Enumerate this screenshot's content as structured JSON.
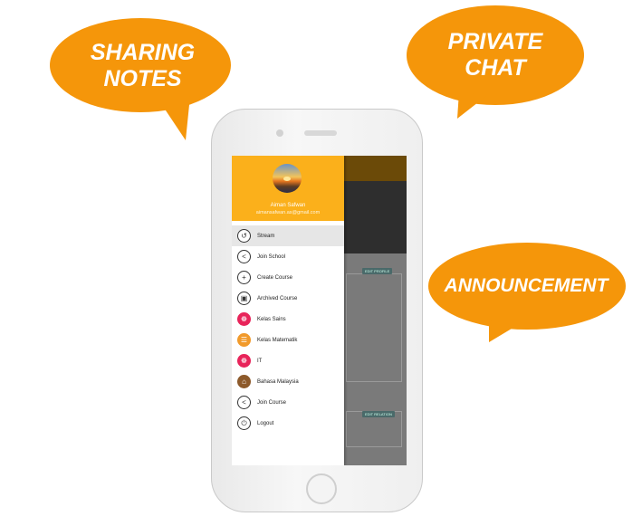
{
  "bubbles": {
    "sharing": {
      "line1": "SHARING",
      "line2": "NOTES",
      "color": "#f5960a"
    },
    "private": {
      "line1": "PRIVATE",
      "line2": "CHAT",
      "color": "#f5960a"
    },
    "announcement": {
      "text": "ANNOUNCEMENT",
      "color": "#f5960a"
    }
  },
  "drawer": {
    "user_name": "Aiman Safwan",
    "user_email": "aimansafwan.as@gmail.com",
    "header_color": "#fbb01b",
    "items": [
      {
        "label": "Stream",
        "icon": "history-icon"
      },
      {
        "label": "Join School",
        "icon": "share-icon"
      },
      {
        "label": "Create Course",
        "icon": "plus-icon"
      },
      {
        "label": "Archived Course",
        "icon": "archive-icon"
      },
      {
        "label": "Kelas Sains",
        "icon": "atom-icon"
      },
      {
        "label": "Kelas Matematik",
        "icon": "abacus-icon"
      },
      {
        "label": "IT",
        "icon": "atom-icon"
      },
      {
        "label": "Bahasa Malaysia",
        "icon": "building-icon"
      },
      {
        "label": "Join Course",
        "icon": "share-icon"
      },
      {
        "label": "Logout",
        "icon": "power-icon"
      }
    ]
  },
  "background": {
    "edit_profile": "EDIT PROFILE",
    "edit_relation": "EDIT RELATION"
  }
}
